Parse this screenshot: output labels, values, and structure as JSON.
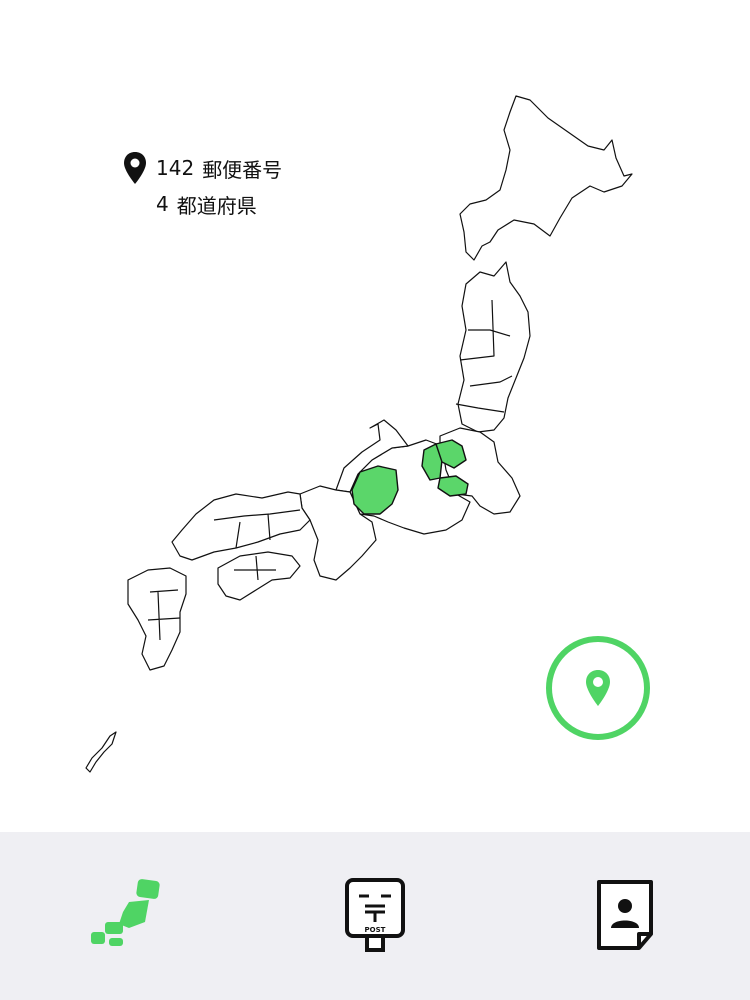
{
  "stats": {
    "postal_count": "142",
    "postal_label": "郵便番号",
    "prefecture_count": "4",
    "prefecture_label": "都道府県"
  },
  "map": {
    "highlight_color": "#5bd66a",
    "highlighted_prefectures": [
      "岐阜",
      "長野",
      "群馬",
      "山梨"
    ]
  },
  "colors": {
    "accent": "#4fd464",
    "tab_bar_bg": "#efeff3",
    "text": "#111111"
  },
  "tabs": [
    {
      "name": "map",
      "icon": "japan-map-icon",
      "active": true
    },
    {
      "name": "post",
      "icon": "post-box-icon",
      "active": false,
      "icon_text": "POST"
    },
    {
      "name": "profile",
      "icon": "contact-card-icon",
      "active": false
    }
  ]
}
